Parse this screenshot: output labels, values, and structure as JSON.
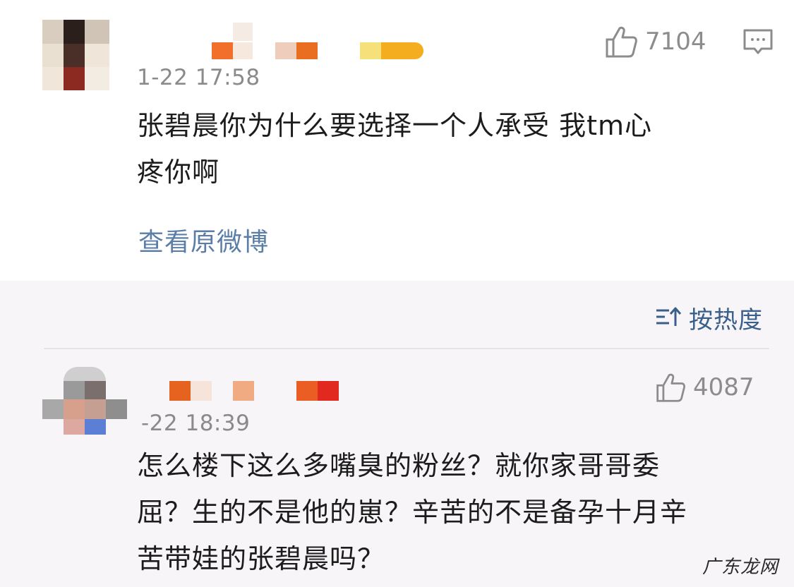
{
  "comments": [
    {
      "time": "1-22 17:58",
      "likes": "7104",
      "text_lines": [
        "张碧晨你为什么要选择一个人承受 我tm心",
        "疼你啊"
      ],
      "view_original": "查看原微博"
    },
    {
      "time": "-22 18:39",
      "likes": "4087",
      "text_lines": [
        "怎么楼下这么多嘴臭的粉丝？就你家哥哥委",
        "屈？生的不是他的崽？辛苦的不是备孕十月辛",
        "苦带娃的张碧晨吗？"
      ]
    }
  ],
  "sort": {
    "label": "按热度",
    "icon": "sort-icon"
  },
  "icons": {
    "like": "thumbs-up-icon",
    "comment": "comment-icon"
  },
  "colors": {
    "link": "#5b7ea8",
    "sort": "#3a5f8a",
    "muted": "#8a8a8a"
  },
  "watermark": "广东龙网"
}
